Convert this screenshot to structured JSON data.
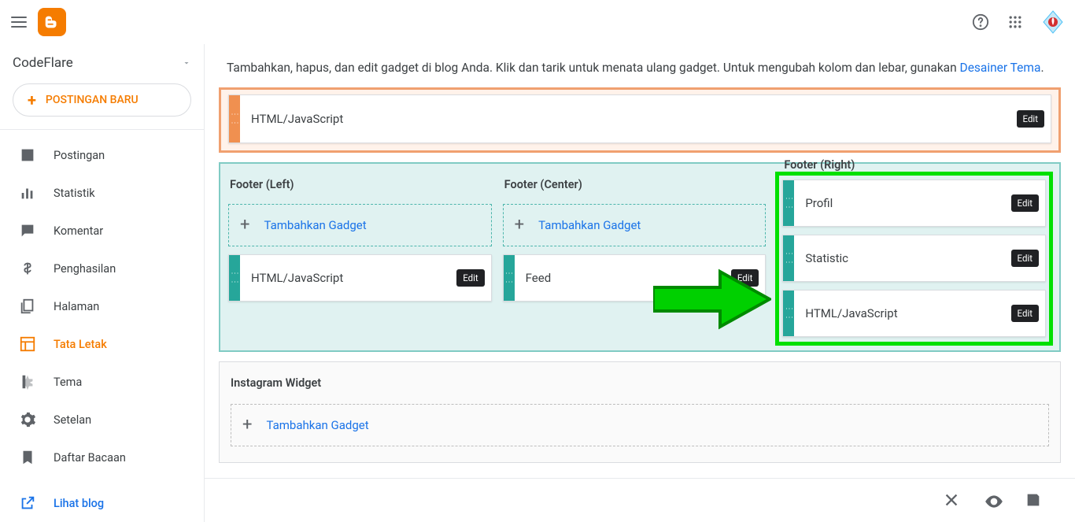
{
  "appbar": {
    "logo_letter": "B"
  },
  "sidebar": {
    "blog_name": "CodeFlare",
    "newpost_label": "POSTINGAN BARU",
    "items": [
      {
        "label": "Postingan",
        "icon": "post"
      },
      {
        "label": "Statistik",
        "icon": "stats"
      },
      {
        "label": "Komentar",
        "icon": "comment"
      },
      {
        "label": "Penghasilan",
        "icon": "dollar"
      },
      {
        "label": "Halaman",
        "icon": "pages"
      },
      {
        "label": "Tata Letak",
        "icon": "layout"
      },
      {
        "label": "Tema",
        "icon": "theme"
      },
      {
        "label": "Setelan",
        "icon": "settings"
      },
      {
        "label": "Daftar Bacaan",
        "icon": "bookmark"
      }
    ],
    "view_blog_label": "Lihat blog"
  },
  "main": {
    "description_pre": "Tambahkan, hapus, dan edit gadget di blog Anda. Klik dan tarik untuk menata ulang gadget. Untuk mengubah kolom dan lebar, gunakan ",
    "description_link": "Desainer Tema",
    "description_post": "."
  },
  "edit_label": "Edit",
  "add_gadget_label": "Tambahkan Gadget",
  "top_gadget": {
    "label": "HTML/JavaScript"
  },
  "footer": {
    "left": {
      "title": "Footer (Left)",
      "gadgets": [
        {
          "label": "HTML/JavaScript"
        }
      ]
    },
    "center": {
      "title": "Footer (Center)",
      "gadgets": [
        {
          "label": "Feed"
        }
      ]
    },
    "right": {
      "title": "Footer (Right)",
      "gadgets": [
        {
          "label": "Profil"
        },
        {
          "label": "Statistic"
        },
        {
          "label": "HTML/JavaScript"
        }
      ]
    }
  },
  "instagram": {
    "title": "Instagram Widget"
  }
}
